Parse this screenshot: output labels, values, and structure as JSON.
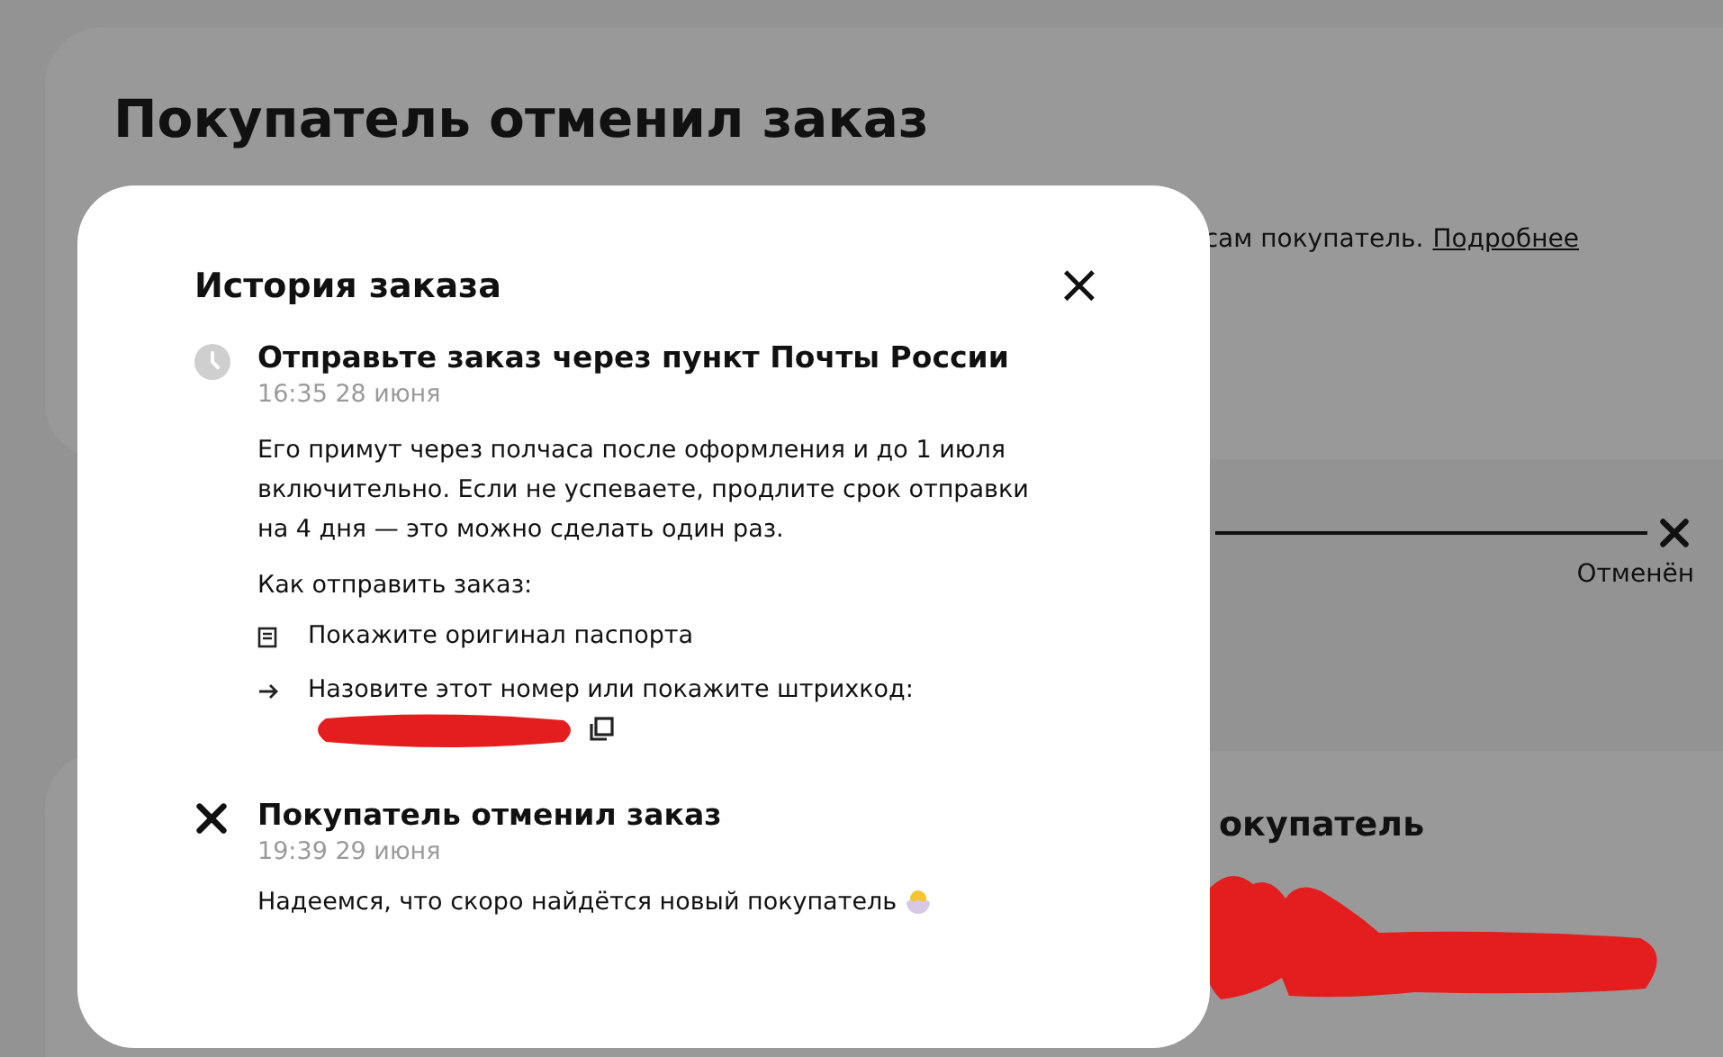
{
  "page": {
    "title": "Покупатель отменил заказ",
    "notice_text": "сам покупатель.",
    "notice_link": "Подробнее",
    "progress_status": "Отменён",
    "second_card_heading": "окупатель"
  },
  "modal": {
    "title": "История заказа",
    "close": "×",
    "events": [
      {
        "kind": "pending",
        "title": "Отправьте заказ через пункт Почты России",
        "time": "16:35 28 июня",
        "body": "Его примут через полчаса после оформления и до 1 июля включительно. Если не успеваете, продлите срок отправки на 4 дня — это можно сделать один раз.",
        "steps_heading": "Как отправить заказ:",
        "steps": [
          {
            "kind": "document",
            "text": "Покажите оригинал паспорта"
          },
          {
            "kind": "arrow",
            "text": "Назовите этот номер или покажите штрихкод:",
            "copyable": true
          }
        ]
      },
      {
        "kind": "cancelled",
        "title": "Покупатель отменил заказ",
        "time": "19:39 29 июня",
        "body": "Надеемся, что скоро найдётся новый покупатель"
      }
    ]
  }
}
